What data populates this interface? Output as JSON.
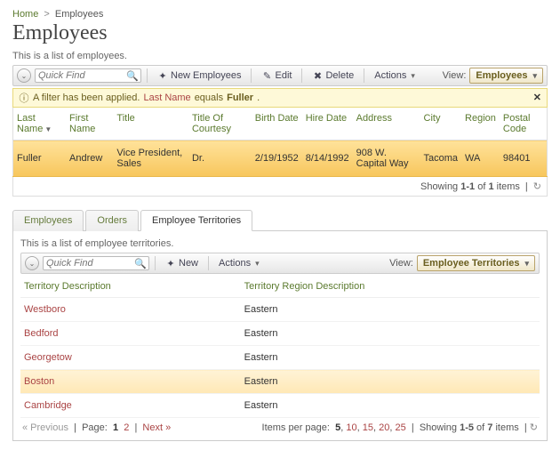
{
  "breadcrumb": {
    "home": "Home",
    "current": "Employees"
  },
  "page_title": "Employees",
  "description": "This is a list of employees.",
  "toolbar": {
    "quick_find_placeholder": "Quick Find",
    "new_label": "New Employees",
    "edit_label": "Edit",
    "delete_label": "Delete",
    "actions_label": "Actions",
    "view_label": "View:",
    "view_value": "Employees"
  },
  "filter_notice": {
    "prefix": "A filter has been applied.",
    "field": "Last Name",
    "op": "equals",
    "value": "Fuller",
    "suffix": "."
  },
  "emp_columns": [
    "Last Name",
    "First Name",
    "Title",
    "Title Of Courtesy",
    "Birth Date",
    "Hire Date",
    "Address",
    "City",
    "Region",
    "Postal Code"
  ],
  "emp_rows": [
    {
      "last": "Fuller",
      "first": "Andrew",
      "title": "Vice President, Sales",
      "courtesy": "Dr.",
      "birth": "2/19/1952",
      "hire": "8/14/1992",
      "address": "908 W. Capital Way",
      "city": "Tacoma",
      "region": "WA",
      "postal": "98401"
    }
  ],
  "emp_pager": {
    "text_prefix": "Showing ",
    "range": "1-1",
    "of": " of ",
    "total": "1",
    "suffix": " items"
  },
  "tabs": {
    "t0": "Employees",
    "t1": "Orders",
    "t2": "Employee Territories",
    "active": 2
  },
  "sub_description": "This is a list of employee territories.",
  "sub_toolbar": {
    "quick_find_placeholder": "Quick Find",
    "new_label": "New",
    "actions_label": "Actions",
    "view_label": "View:",
    "view_value": "Employee Territories"
  },
  "sub_columns": [
    "Territory Description",
    "Territory Region Description"
  ],
  "sub_rows": [
    {
      "territory": "Westboro",
      "region": "Eastern",
      "hover": false
    },
    {
      "territory": "Bedford",
      "region": "Eastern",
      "hover": false
    },
    {
      "territory": "Georgetow",
      "region": "Eastern",
      "hover": false
    },
    {
      "territory": "Boston",
      "region": "Eastern",
      "hover": true
    },
    {
      "territory": "Cambridge",
      "region": "Eastern",
      "hover": false
    }
  ],
  "sub_pager": {
    "prev": "« Previous",
    "page_label": "Page:",
    "pages": [
      "1",
      "2"
    ],
    "current_page": "1",
    "next": "Next »",
    "ipp_label": "Items per page:",
    "ipp_options": [
      "5",
      "10",
      "15",
      "20",
      "25"
    ],
    "ipp_current": "5",
    "showing_prefix": "Showing ",
    "range": "1-5",
    "of": " of ",
    "total": "7",
    "suffix": " items"
  }
}
